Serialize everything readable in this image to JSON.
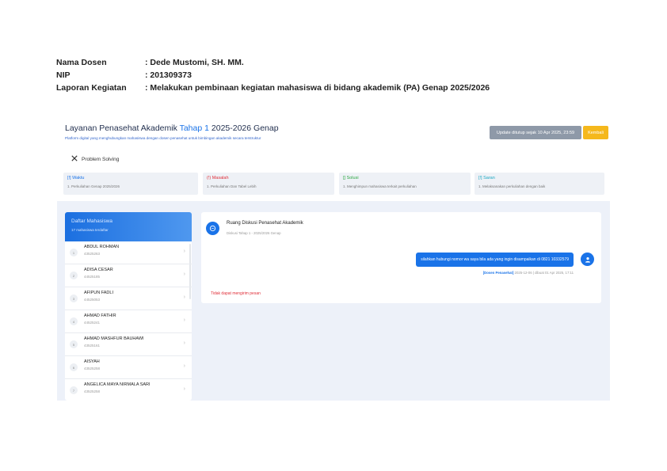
{
  "doc": {
    "rows": [
      {
        "label": "Nama Dosen",
        "value": ": Dede Mustomi, SH. MM."
      },
      {
        "label": "NIP",
        "value": ": 201309373"
      },
      {
        "label": "Laporan Kegiatan",
        "value": ": Melakukan pembinaan kegiatan mahasiswa di bidang akademik (PA) Genap 2025/2026"
      }
    ]
  },
  "page": {
    "title_prefix": "Layanan Penasehat Akademik",
    "title_highlight": "Tahap 1",
    "title_suffix": "2025-2026 Genap",
    "subtitle": "Platform digital yang menghubungkan mahasiswa dengan dosen penasehat untuk bimbingan akademik secara terstruktur",
    "update_label": "Update ditutup sejak 10 Apr 2025, 23:59",
    "back_label": "Kembali"
  },
  "problem_solving": {
    "title": "Problem Solving",
    "cards": [
      {
        "heading": "[!] Waktu",
        "text": "1. Perkuliahan Genap 2025/2026"
      },
      {
        "heading": "(!) Masalah",
        "text": "1. Perkuliahan Dan Tabel Lebih"
      },
      {
        "heading": "[] Solusi",
        "text": "1. Menghimpun mahasiswa terkait perkuliahan"
      },
      {
        "heading": "[!] Saran",
        "text": "1. Melaksanakan perkuliahan dengan baik"
      }
    ]
  },
  "students": {
    "title": "Daftar Mahasiswa",
    "subtitle": "17 mahasiswa terdaftar",
    "items": [
      {
        "num": "1",
        "name": "ABDUL ROHMAN",
        "id": "43525263"
      },
      {
        "num": "2",
        "name": "ADISA CESAR",
        "id": "44525185"
      },
      {
        "num": "3",
        "name": "AFIPUN FADLI",
        "id": "44525053"
      },
      {
        "num": "4",
        "name": "AHMAD FATHIR",
        "id": "44525241"
      },
      {
        "num": "5",
        "name": "AHMAD MASHFUR BAUHAWI",
        "id": "43525161"
      },
      {
        "num": "6",
        "name": "AISYAH",
        "id": "43525258"
      },
      {
        "num": "7",
        "name": "ANGELICA MAYA NIRMALA SARI",
        "id": "43525258"
      }
    ]
  },
  "chat": {
    "title": "Ruang Diskusi Penasehat Akademik",
    "subtitle": "Diskusi Tahap 1 - 2025/2026 Genap",
    "message": "silahkan hubungi nomor wa saya bila ada yang ingin disampaikan di 0821 10332579",
    "meta_author": "[Dosen Penasehat]",
    "meta_text": "2025-12-06 | dibuat 01 Apr 2025, 17:11",
    "cannot_send": "Tidak dapat mengirim pesan"
  },
  "icons": {
    "problem": "tools-icon",
    "chat": "chat-icon",
    "user": "user-icon",
    "chevron": "chevron-right-icon"
  },
  "colors": {
    "accent": "#1a73e8",
    "warning": "#f5b81c",
    "danger": "#e0303a",
    "success": "#2ea844",
    "info": "#1ba7c2",
    "muted_button": "#8e99a8",
    "background": "#edf1f9"
  }
}
